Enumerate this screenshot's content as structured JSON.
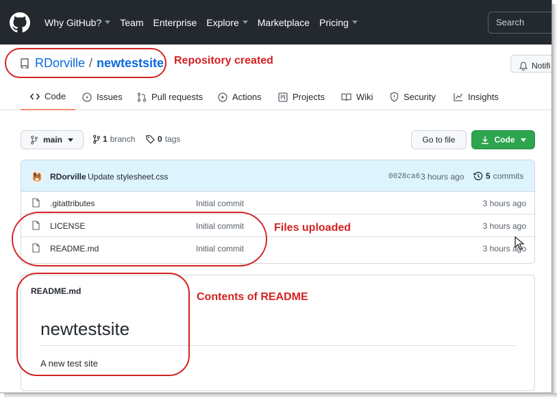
{
  "nav": {
    "items": [
      {
        "label": "Why GitHub?",
        "caret": true
      },
      {
        "label": "Team",
        "caret": false
      },
      {
        "label": "Enterprise",
        "caret": false
      },
      {
        "label": "Explore",
        "caret": true
      },
      {
        "label": "Marketplace",
        "caret": false
      },
      {
        "label": "Pricing",
        "caret": true
      }
    ],
    "search_placeholder": "Search"
  },
  "repo": {
    "owner": "RDorville",
    "separator": "/",
    "name": "newtestsite",
    "notifications_label": "Notifi"
  },
  "tabs": [
    {
      "label": "Code",
      "icon": "code-icon",
      "active": true
    },
    {
      "label": "Issues",
      "icon": "issue-icon",
      "active": false
    },
    {
      "label": "Pull requests",
      "icon": "pull-request-icon",
      "active": false
    },
    {
      "label": "Actions",
      "icon": "play-icon",
      "active": false
    },
    {
      "label": "Projects",
      "icon": "project-icon",
      "active": false
    },
    {
      "label": "Wiki",
      "icon": "book-icon",
      "active": false
    },
    {
      "label": "Security",
      "icon": "shield-icon",
      "active": false
    },
    {
      "label": "Insights",
      "icon": "graph-icon",
      "active": false
    }
  ],
  "branch_bar": {
    "branch": "main",
    "branch_count": "1",
    "branch_word": "branch",
    "tag_count": "0",
    "tag_word": "tags",
    "go_to_file": "Go to file",
    "code_button": "Code"
  },
  "latest_commit": {
    "author": "RDorville",
    "message": "Update stylesheet.css",
    "sha": "0028ca6",
    "time": "3 hours ago",
    "count": "5",
    "count_word": "commits"
  },
  "files": [
    {
      "name": ".gitattributes",
      "message": "Initial commit",
      "age": "3 hours ago"
    },
    {
      "name": "LICENSE",
      "message": "Initial commit",
      "age": "3 hours ago"
    },
    {
      "name": "README.md",
      "message": "Initial commit",
      "age": "3 hours ago"
    }
  ],
  "readme": {
    "filename": "README.md",
    "heading": "newtestsite",
    "body": "A new test site"
  },
  "annotations": {
    "repo_created": "Repository created",
    "files_uploaded": "Files uploaded",
    "readme_contents": "Contents of README"
  },
  "colors": {
    "header_bg": "#24292f",
    "link": "#0969da",
    "primary_button": "#2da44e",
    "active_tab_underline": "#fd8c73",
    "annotation": "#d42121"
  }
}
